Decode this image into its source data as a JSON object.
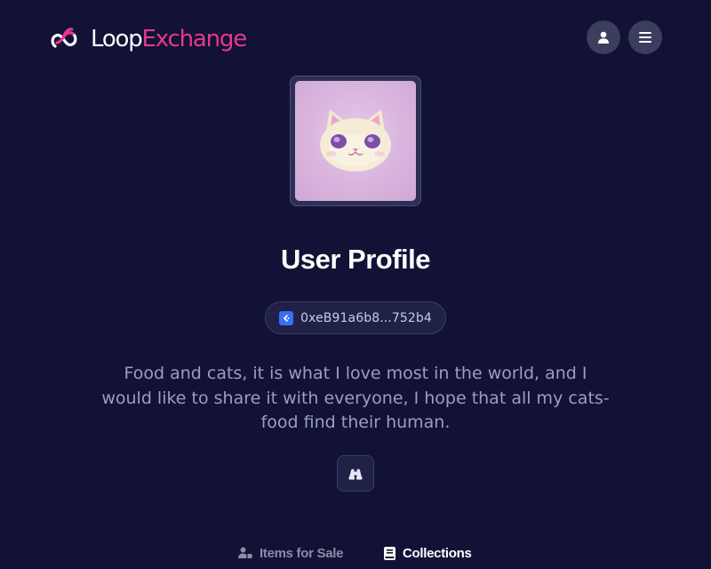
{
  "header": {
    "logo": {
      "part1": "Loop",
      "part2": "Exchange",
      "icon": "infinity-loop-logo",
      "color_primary": "#ffffff",
      "color_accent": "#e6388c"
    },
    "buttons": [
      {
        "icon": "user-icon"
      },
      {
        "icon": "menu-icon"
      }
    ]
  },
  "profile": {
    "avatar_icon": "cat-face-image",
    "title": "User Profile",
    "address": "0xeB91a6b8...752b4",
    "address_icon": "chain-badge-icon",
    "bio": "Food and cats, it is what I love most in the world, and I would like to share it with everyone, I hope that all my cats-food find their human.",
    "explore_icon": "binoculars-icon"
  },
  "tabs": [
    {
      "label": "Items for Sale",
      "icon": "user-tag-icon",
      "active": false
    },
    {
      "label": "Collections",
      "icon": "book-icon",
      "active": true
    }
  ],
  "colors": {
    "background": "#111236",
    "accent": "#e6388c",
    "muted_text": "#9c9fba",
    "chain_badge": "#3b6ef6"
  }
}
